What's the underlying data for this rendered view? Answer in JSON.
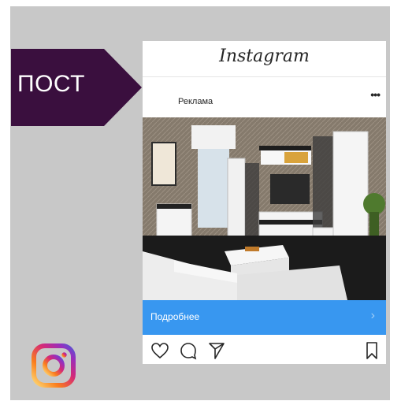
{
  "slide": {
    "label": "ПОСТ",
    "label_bg": "#3a0f3e",
    "frame_bg": "#c8c8c8"
  },
  "post": {
    "brand": "Instagram",
    "sponsored_label": "Реклама",
    "more_icon": "•••",
    "photo_description_icon": "living-room-furniture-photo",
    "cta_label": "Подробнее",
    "cta_arrow": "›",
    "cta_color": "#3897f0"
  },
  "actions": {
    "like_icon": "heart-icon",
    "comment_icon": "comment-icon",
    "share_icon": "send-icon",
    "save_icon": "bookmark-icon"
  },
  "logo": {
    "name": "instagram-logo-icon"
  }
}
